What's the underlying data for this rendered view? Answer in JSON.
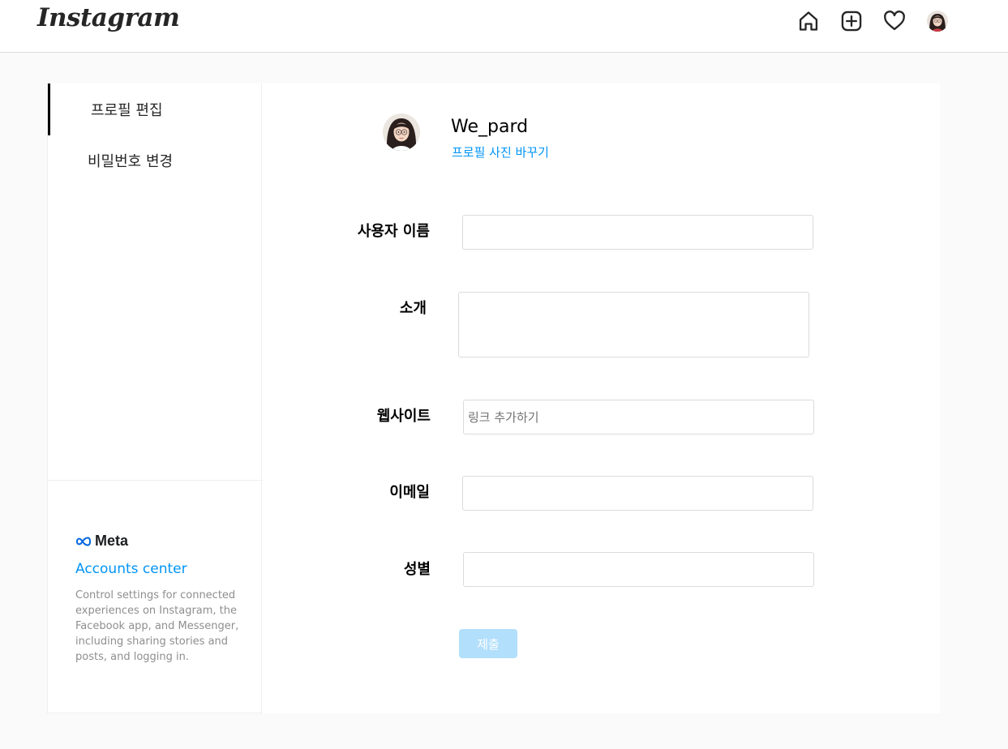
{
  "brand": {
    "logo_text": "Instagram"
  },
  "nav": {
    "icons": [
      "home-icon",
      "create-post-icon",
      "activity-heart-icon",
      "profile-avatar-icon"
    ]
  },
  "sidebar": {
    "items": [
      {
        "label": "프로필 편집",
        "active": true
      },
      {
        "label": "비밀번호 변경",
        "active": false
      }
    ],
    "meta_logo": "Meta",
    "accounts_center": "Accounts center",
    "accounts_description": "Control settings for connected experiences on Instagram, the Facebook app, and Messenger, including sharing stories and posts, and logging in."
  },
  "profile": {
    "username": "We_pard",
    "change_photo": "프로필 사진 바꾸기"
  },
  "form": {
    "username_label": "사용자 이름",
    "username_value": "",
    "bio_label": "소개",
    "bio_value": "",
    "website_label": "웹사이트",
    "website_placeholder": "링크 추가하기",
    "email_label": "이메일",
    "email_value": "",
    "gender_label": "성별",
    "gender_value": "",
    "submit_label": "제출"
  },
  "colors": {
    "accent": "#0095f6",
    "submit_disabled": "#b2dffc",
    "page_bg": "#fafafa",
    "border": "#dbdbdb"
  }
}
